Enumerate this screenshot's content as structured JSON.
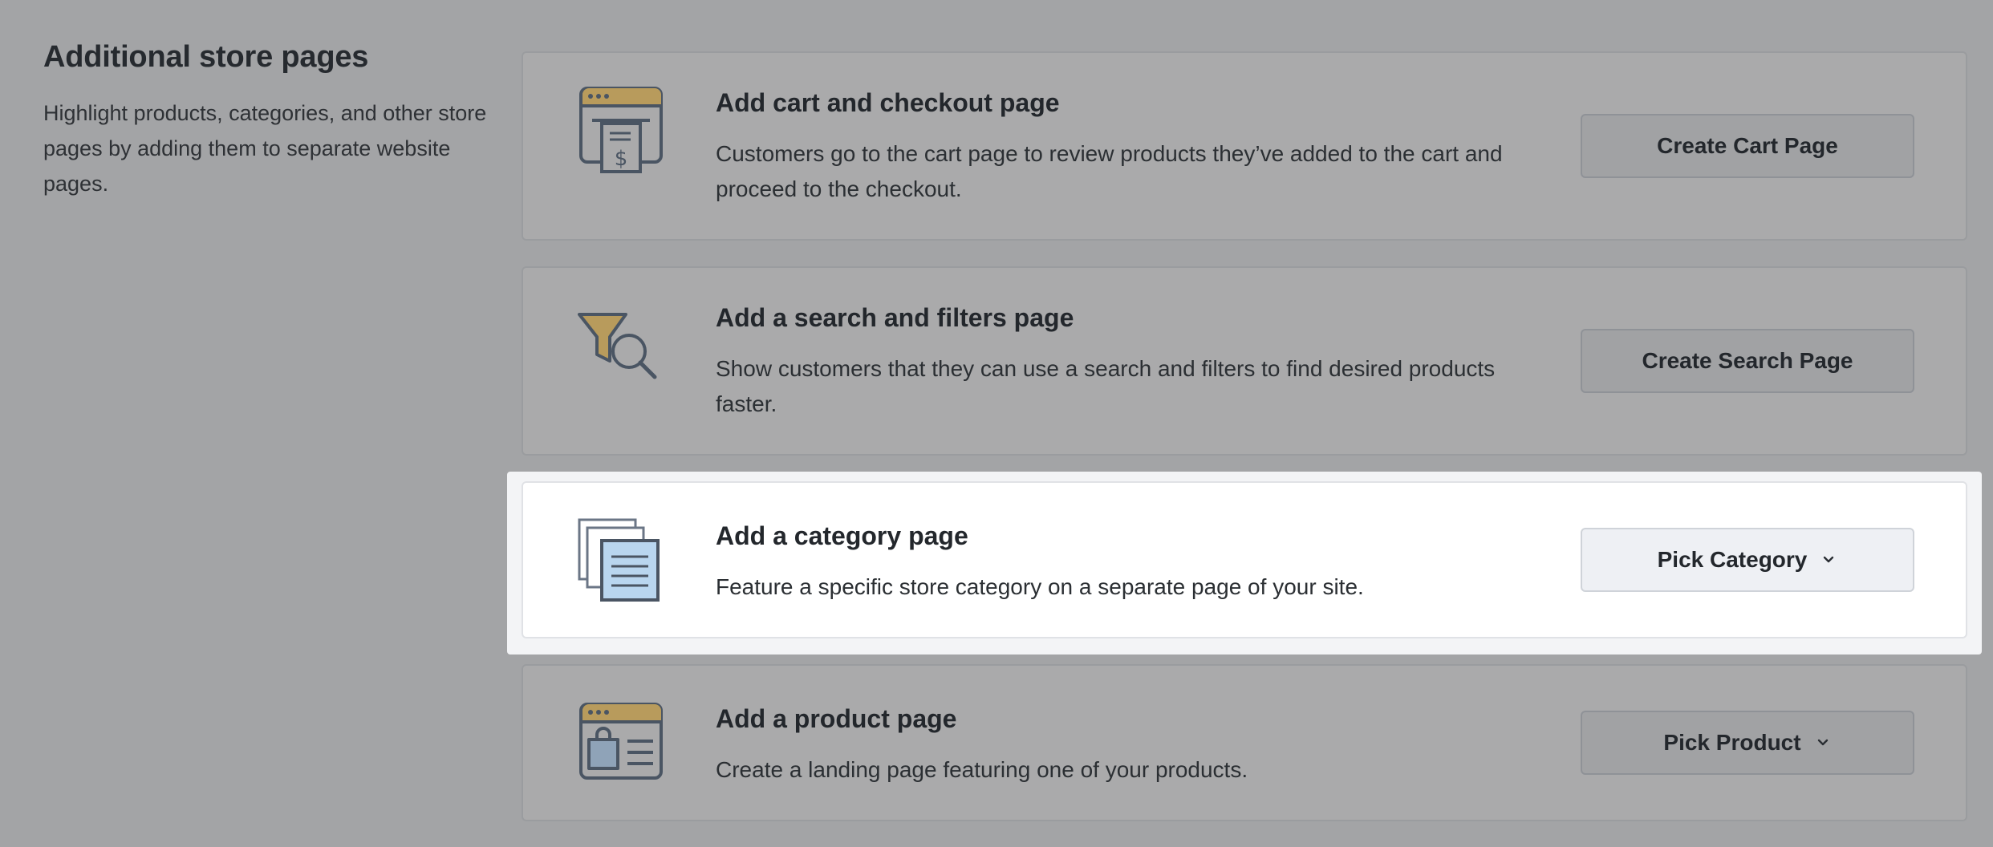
{
  "intro": {
    "title": "Additional store pages",
    "description": "Highlight products, categories, and other store pages by adding them to separate website pages."
  },
  "cards": [
    {
      "title": "Add cart and checkout page",
      "description": "Customers go to the cart page to review products they’ve added to the cart and proceed to the checkout.",
      "button_label": "Create Cart Page",
      "icon": "cart-checkout-icon"
    },
    {
      "title": "Add a search and filters page",
      "description": "Show customers that they can use a search and filters to find desired products faster.",
      "button_label": "Create Search Page",
      "icon": "search-filter-icon"
    },
    {
      "title": "Add a category page",
      "description": "Feature a specific store category on a separate page of your site.",
      "button_label": "Pick Category",
      "icon": "category-pages-icon"
    },
    {
      "title": "Add a product page",
      "description": "Create a landing page featuring one of your products.",
      "button_label": "Pick Product",
      "icon": "product-page-icon"
    }
  ],
  "colors": {
    "overlay_background": "#a3a4a6",
    "icon_gold": "#b89b5c",
    "icon_stroke": "#4a5563",
    "icon_blue": "#b9d6ef"
  }
}
